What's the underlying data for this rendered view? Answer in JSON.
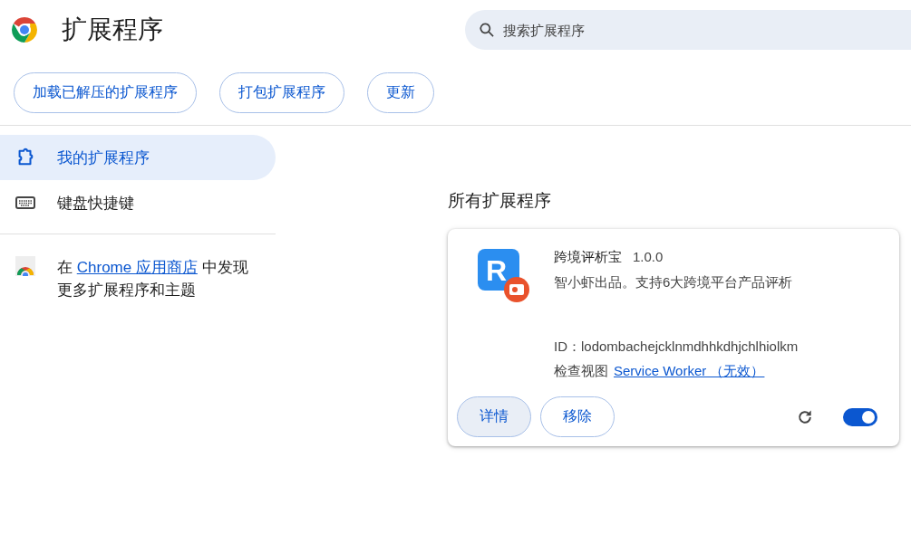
{
  "header": {
    "title": "扩展程序",
    "search": {
      "placeholder": "搜索扩展程序"
    }
  },
  "toolbar": {
    "buttons": [
      "加载已解压的扩展程序",
      "打包扩展程序",
      "更新"
    ]
  },
  "sidebar": {
    "items": [
      {
        "label": "我的扩展程序",
        "kind": "extension",
        "selected": true
      },
      {
        "label": "键盘快捷键",
        "kind": "keyboard",
        "selected": false
      }
    ],
    "store_promo": {
      "before": "在",
      "link": "Chrome 应用商店",
      "after": "中发现更多扩展程序和主题"
    }
  },
  "main": {
    "section_title": "所有扩展程序",
    "extensions": [
      {
        "logo_letter": "R",
        "name": "跨境评析宝",
        "version": "1.0.0",
        "description": "智小虾出品。支持6大跨境平台产品评析",
        "id": "ID：lodombachejcklnmdhhkdhjchlhiolkm",
        "inspect_label": "检查视图",
        "inspect_link": "Service Worker （无效）",
        "buttons": [
          {
            "label": "详情",
            "highlighted": true
          },
          {
            "label": "移除",
            "highlighted": false
          }
        ],
        "enabled": true
      }
    ]
  }
}
